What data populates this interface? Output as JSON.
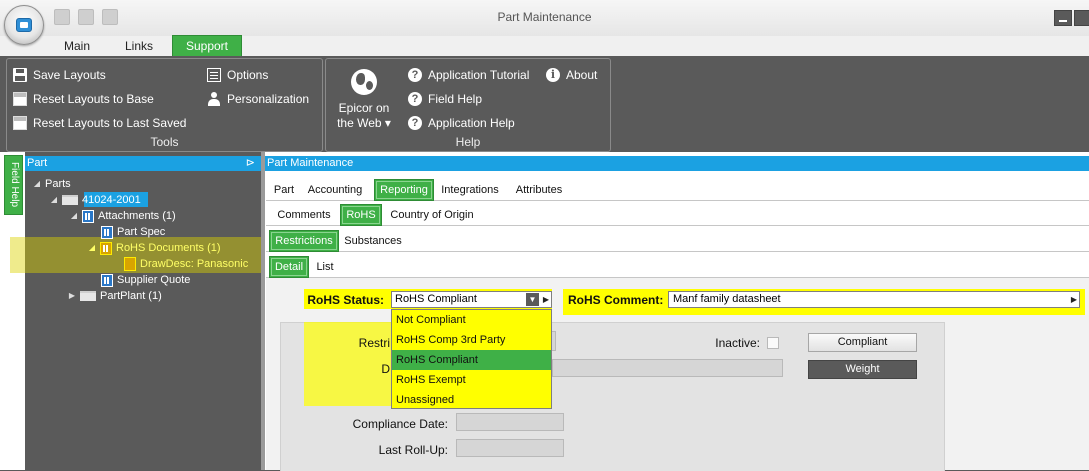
{
  "window": {
    "title": "Part Maintenance"
  },
  "ribbon_tabs": [
    "Main",
    "Links",
    "Support"
  ],
  "ribbon": {
    "tools": {
      "label": "Tools",
      "save_layouts": "Save Layouts",
      "reset_layouts_base": "Reset Layouts to Base",
      "reset_layouts_last": "Reset Layouts to Last Saved",
      "options": "Options",
      "personalization": "Personalization"
    },
    "help": {
      "label": "Help",
      "epicor_web": "Epicor on\nthe Web ▾",
      "app_tutorial": "Application Tutorial",
      "about": "About",
      "field_help": "Field Help",
      "app_help": "Application Help"
    }
  },
  "side": {
    "field_help_tab": "Field Help"
  },
  "tree": {
    "header": "Part",
    "pin": "⊳",
    "nodes": {
      "parts": "Parts",
      "part_number": "41024-2001",
      "attachments": "Attachments (1)",
      "part_spec": "Part Spec",
      "rohs_documents": "RoHS Documents (1)",
      "drawdesc": "DrawDesc: Panasonic",
      "supplier_quote": "Supplier Quote",
      "partplant": "PartPlant (1)"
    }
  },
  "main": {
    "header": "Part Maintenance",
    "tabs_l1": [
      "Part",
      "Accounting",
      "Reporting",
      "Integrations",
      "Attributes"
    ],
    "tabs_l2": [
      "Comments",
      "RoHS",
      "Country of Origin"
    ],
    "tabs_l3": [
      "Restrictions",
      "Substances"
    ],
    "tabs_l4": [
      "Detail",
      "List"
    ]
  },
  "form": {
    "rohs_status_label": "RoHS Status:",
    "rohs_status_value": "RoHS Compliant",
    "rohs_comment_label": "RoHS Comment:",
    "rohs_comment_value": "Manf family datasheet",
    "restr_label": "Restri",
    "d_label": "D",
    "inactive_label": "Inactive:",
    "compliance_date_label": "Compliance Date:",
    "last_rollup_label": "Last Roll-Up:",
    "compliant_btn": "Compliant",
    "weight_btn": "Weight",
    "dropdown_options": [
      "Not Compliant",
      "RoHS Comp 3rd Party",
      "RoHS Compliant",
      "RoHS Exempt",
      "Unassigned"
    ]
  }
}
